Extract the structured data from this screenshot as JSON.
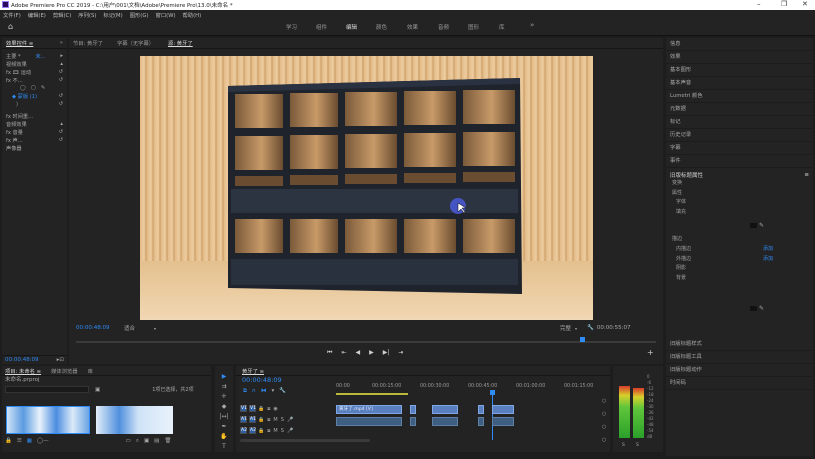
{
  "window": {
    "title": "Adobe Premiere Pro CC 2019 - C:\\用户\\001\\文档\\Adobe\\Premiere Pro\\13.0\\未命名 *",
    "minimize": "–",
    "maximize": "❐",
    "close": "✕"
  },
  "menu": [
    "文件(F)",
    "编辑(E)",
    "剪辑(C)",
    "序列(S)",
    "标记(M)",
    "图形(G)",
    "窗口(W)",
    "帮助(H)"
  ],
  "workspaces": {
    "home": "⌂",
    "items": [
      "学习",
      "组件",
      "编辑",
      "颜色",
      "效果",
      "音频",
      "图形",
      "库"
    ],
    "more": "»"
  },
  "left_panel": {
    "tabs": {
      "effect_controls": "效果控件 ≡",
      "chevron": "»"
    },
    "master": "主要 *",
    "master_value": "未...",
    "arrow_right": "▸",
    "video_effects": "视频效果",
    "rows": [
      {
        "label": "fx 🎞 运动"
      },
      {
        "label": "fx 不..."
      },
      {
        "label": "fx 时间重..."
      },
      {
        "label": "音频效果"
      },
      {
        "label": "fx 音量"
      },
      {
        "label": "fx 声..."
      },
      {
        "label": "声像器"
      }
    ],
    "time": "00:00:48:09",
    "shapes": [
      "◯",
      "▢",
      "✎"
    ]
  },
  "program_panel": {
    "tabs": [
      "节目: 黄牙了",
      "字幕（无字幕）",
      "源: 黄牙了"
    ],
    "active_tab": 2,
    "timecode": "00:00:48:09",
    "zoom": "适合",
    "quality": "完整",
    "duration": "00:00:55:07",
    "transport": [
      "⏮",
      "⇤",
      "◀",
      "▶",
      "▶|",
      "⇥"
    ],
    "add": "+"
  },
  "right_panel": {
    "items": [
      "信息",
      "效果",
      "基本图形",
      "基本声音",
      "Lumetri 颜色",
      "元数据",
      "标记",
      "历史记录",
      "字幕",
      "事件"
    ],
    "section_title": "旧版标题属性",
    "subitems": [
      "变换",
      "属性",
      "字体",
      "填充",
      "描边",
      "内描边",
      "外描边",
      "阴影",
      "背景"
    ],
    "add_label_1": "添加",
    "add_label_2": "添加",
    "bottom_items": [
      "旧版标题样式",
      "旧版标题工具",
      "旧版标题动作",
      "时间码"
    ]
  },
  "project_panel": {
    "tabs": [
      "项目: 未命名 ≡",
      "媒体浏览器",
      "库"
    ],
    "file": "未命名.prproj",
    "selected": "1项已选择，共2项",
    "search_placeholder": ""
  },
  "timeline": {
    "tab": "黄牙了 ≡",
    "timecode": "00:00:48:09",
    "ruler": [
      "00:00",
      "00:00:15:00",
      "00:00:30:00",
      "00:00:45:00",
      "00:01:00:00",
      "00:01:15:00"
    ],
    "tracks": [
      {
        "name": "V1",
        "label": "V1"
      },
      {
        "name": "A1",
        "label": "A1"
      },
      {
        "name": "A2",
        "label": "A2"
      }
    ],
    "clip_label": "黄牙了.mp4 [V]",
    "M": "M",
    "S": "S"
  },
  "audio_meter": {
    "scale": [
      "0",
      "-6",
      "-12",
      "-18",
      "-24",
      "-30",
      "-36",
      "-42",
      "-48",
      "-54",
      "dB"
    ],
    "levels": [
      0.92,
      0.9
    ],
    "labels": [
      "S",
      "S"
    ]
  },
  "status_time": "00:00:48:09"
}
